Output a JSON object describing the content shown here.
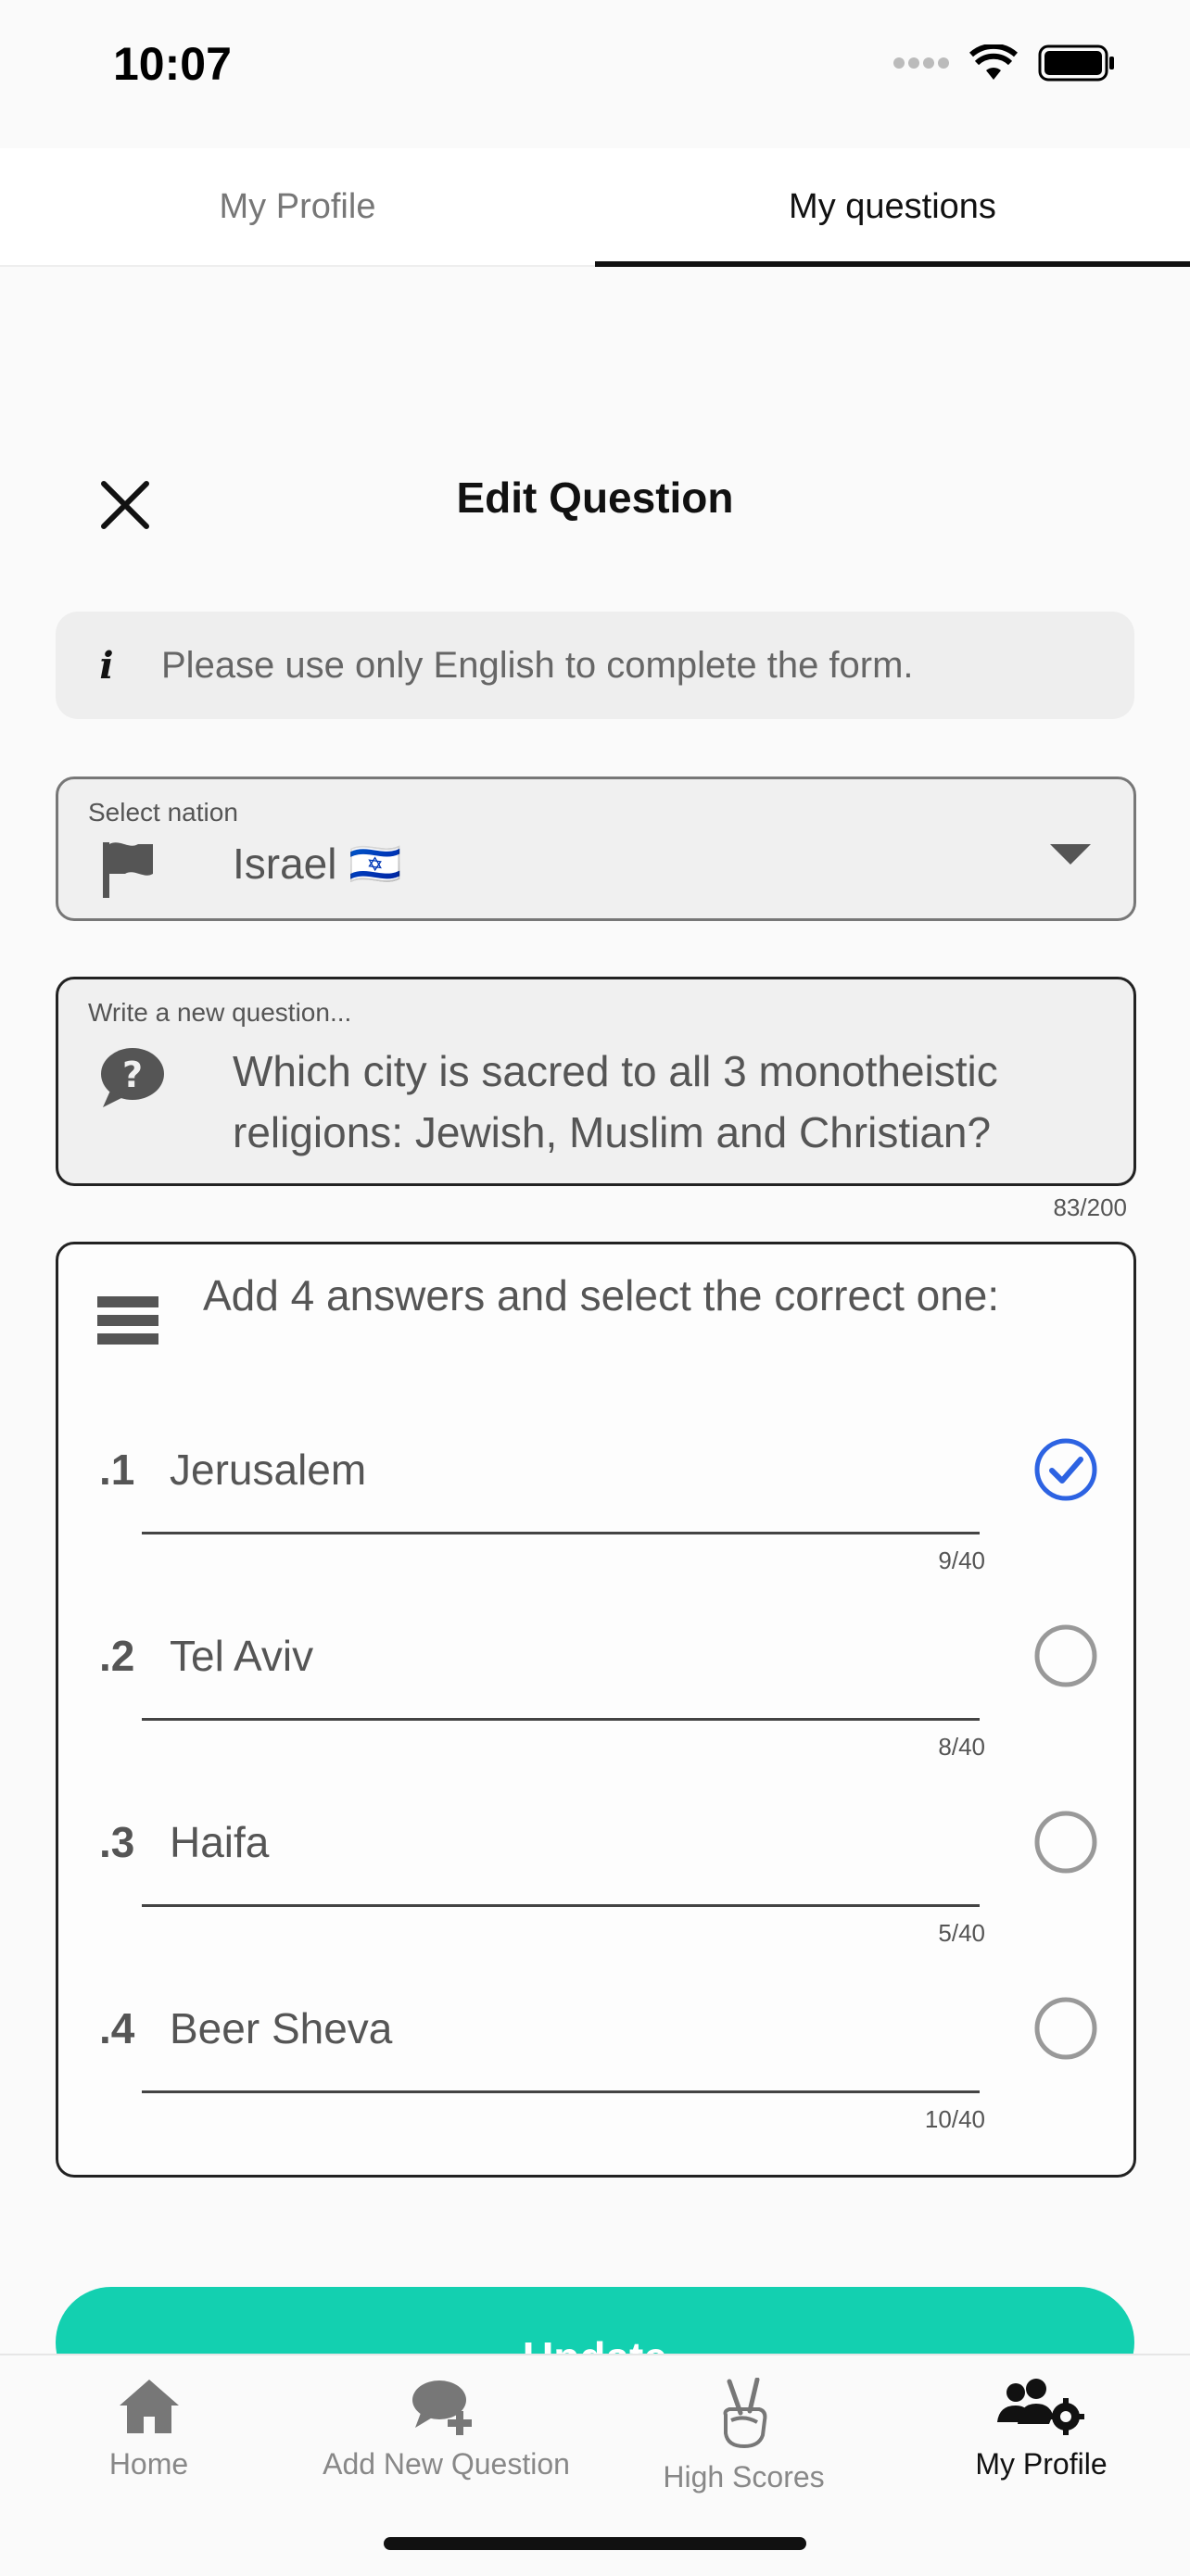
{
  "status_bar": {
    "time": "10:07"
  },
  "tabs": [
    {
      "label": "My Profile",
      "active": false
    },
    {
      "label": "My questions",
      "active": true
    }
  ],
  "header": {
    "title": "Edit Question"
  },
  "info": {
    "text": "Please use only English to complete the form."
  },
  "nation": {
    "label": "Select nation",
    "value": "Israel 🇮🇱"
  },
  "question": {
    "label": "Write a new question...",
    "value": "Which city is sacred to all 3 monotheistic religions: Jewish, Muslim and Christian?",
    "counter": "83/200"
  },
  "answers": {
    "heading": "Add 4 answers and select the correct one:",
    "items": [
      {
        "number": ".1",
        "value": "Jerusalem",
        "counter": "9/40",
        "correct": true
      },
      {
        "number": ".2",
        "value": "Tel Aviv",
        "counter": "8/40",
        "correct": false
      },
      {
        "number": ".3",
        "value": "Haifa",
        "counter": "5/40",
        "correct": false
      },
      {
        "number": ".4",
        "value": "Beer Sheva",
        "counter": "10/40",
        "correct": false
      }
    ]
  },
  "update_button": {
    "label": "Update"
  },
  "bottom_nav": [
    {
      "label": "Home",
      "icon": "home-icon",
      "active": false
    },
    {
      "label": "Add New Question",
      "icon": "add-question-icon",
      "active": false
    },
    {
      "label": "High Scores",
      "icon": "peace-hand-icon",
      "active": false
    },
    {
      "label": "My Profile",
      "icon": "profile-gear-icon",
      "active": true
    }
  ],
  "colors": {
    "accent": "#13d0b0",
    "check": "#2d63e2"
  }
}
